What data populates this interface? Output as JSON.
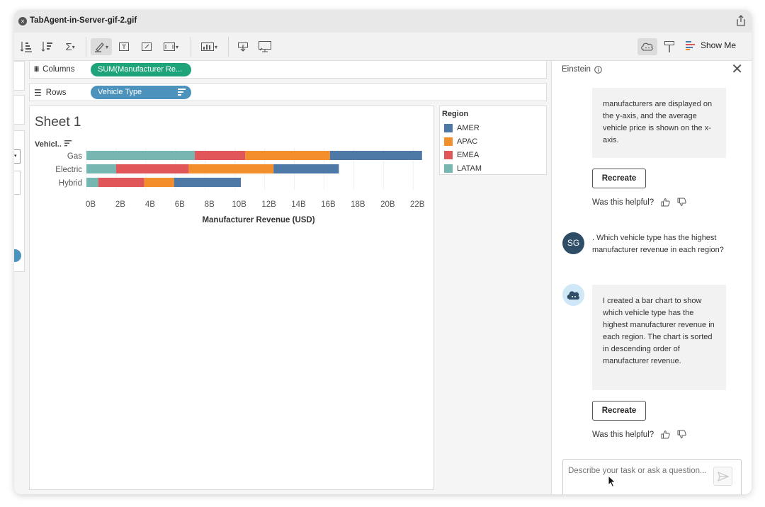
{
  "window": {
    "title": "TabAgent-in-Server-gif-2.gif"
  },
  "toolbar": {
    "show_me_label": "Show Me"
  },
  "shelves": {
    "columns_label": "Columns",
    "columns_pill": "SUM(Manufacturer Re...",
    "rows_label": "Rows",
    "rows_pill": "Vehicle Type"
  },
  "sheet": {
    "title": "Sheet 1",
    "row_header": "Vehicl.."
  },
  "legend": {
    "title": "Region",
    "items": [
      {
        "label": "AMER",
        "color": "#4e79a7"
      },
      {
        "label": "APAC",
        "color": "#f28e2b"
      },
      {
        "label": "EMEA",
        "color": "#e15759"
      },
      {
        "label": "LATAM",
        "color": "#76b7b2"
      }
    ]
  },
  "chart_data": {
    "type": "bar",
    "orientation": "horizontal",
    "stacked": true,
    "categories": [
      "Gas",
      "Electric",
      "Hybrid"
    ],
    "series": [
      {
        "name": "LATAM",
        "color": "#76b7b2",
        "values": [
          7.3,
          2.0,
          0.8
        ]
      },
      {
        "name": "EMEA",
        "color": "#e15759",
        "values": [
          3.4,
          4.9,
          3.1
        ]
      },
      {
        "name": "APAC",
        "color": "#f28e2b",
        "values": [
          5.7,
          5.7,
          2.0
        ]
      },
      {
        "name": "AMER",
        "color": "#4e79a7",
        "values": [
          6.2,
          4.4,
          4.5
        ]
      }
    ],
    "xticks": [
      "0B",
      "2B",
      "4B",
      "6B",
      "8B",
      "10B",
      "12B",
      "14B",
      "16B",
      "18B",
      "20B",
      "22B"
    ],
    "xlim": [
      0,
      22.8
    ],
    "xlabel": "Manufacturer Revenue (USD)",
    "ylabel": "Vehicl..",
    "title": "Sheet 1",
    "grid": true
  },
  "panel": {
    "title": "Einstein",
    "msg1": "manufacturers are displayed on the y-axis, and the average vehicle price is shown on the x-axis.",
    "recreate_label": "Recreate",
    "helpful_label": "Was this helpful?",
    "user_initials": "SG",
    "user_message": ". Which vehicle type has the highest manufacturer revenue in each region?",
    "msg2": "I created a bar chart to show which vehicle type has the highest manufacturer revenue in each region. The chart is sorted in descending order of manufacturer revenue.",
    "input_placeholder": "Describe your task or ask a question..."
  }
}
